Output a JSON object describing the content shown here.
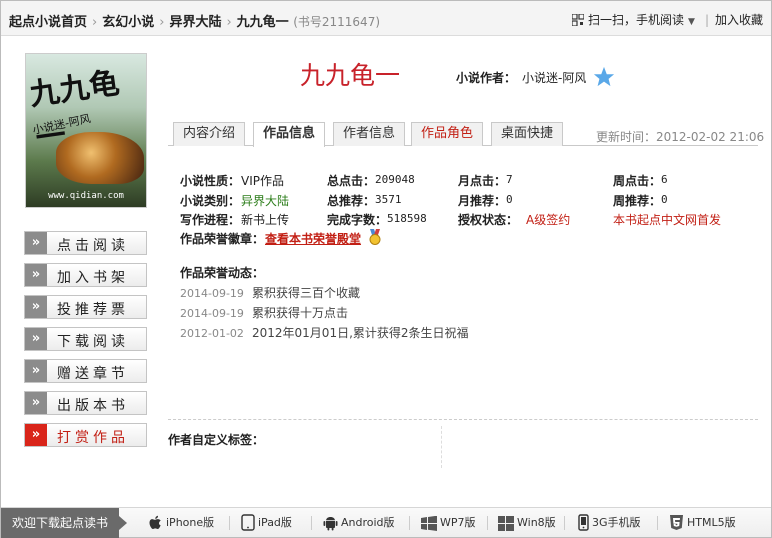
{
  "breadcrumb": {
    "items": [
      "起点小说首页",
      "玄幻小说",
      "异界大陆",
      "九九龟一"
    ],
    "book_no": "(书号2111647)"
  },
  "header_links": {
    "scan": "扫一扫，手机阅读",
    "bookshelf": "加入收藏"
  },
  "cover": {
    "title_text": "九九龟一",
    "author_text": "小说迷-阿风",
    "site_text": "www.qidian.com"
  },
  "left_buttons": [
    "点击阅读",
    "加入书架",
    "投推荐票",
    "下载阅读",
    "赠送章节",
    "出版本书",
    "打赏作品"
  ],
  "book": {
    "title": "九九龟一",
    "author_label": "小说作者：",
    "author_name": "小说迷-阿风"
  },
  "tabs": [
    "内容介绍",
    "作品信息",
    "作者信息",
    "作品角色",
    "桌面快捷"
  ],
  "updated": "更新时间：2012-02-02 21:06",
  "info": {
    "nature_label": "小说性质：",
    "nature_value": "VIP作品",
    "total_clicks_label": "总点击：",
    "total_clicks_value": "209048",
    "month_clicks_label": "月点击：",
    "month_clicks_value": "7",
    "week_clicks_label": "周点击：",
    "week_clicks_value": "6",
    "category_label": "小说类别：",
    "category_value": "异界大陆",
    "total_rec_label": "总推荐：",
    "total_rec_value": "3571",
    "month_rec_label": "月推荐：",
    "month_rec_value": "0",
    "week_rec_label": "周推荐：",
    "week_rec_value": "0",
    "progress_label": "写作进程：",
    "progress_value": "新书上传",
    "words_label": "完成字数：",
    "words_value": "518598",
    "license_label": "授权状态：",
    "license_value": "A级签约",
    "first_pub": "本书起点中文网首发",
    "honor_badge_label": "作品荣誉徽章：",
    "honor_badge_link": "查看本书荣誉殿堂"
  },
  "honors": {
    "title": "作品荣誉动态：",
    "rows": [
      {
        "date": "2014-09-19",
        "text": "累积获得三百个收藏"
      },
      {
        "date": "2014-09-19",
        "text": "累积获得十万点击"
      },
      {
        "date": "2012-01-02",
        "text": "2012年01月01日,累计获得2条生日祝福"
      }
    ]
  },
  "tags_label": "作者自定义标签：",
  "bottom": {
    "download": "欢迎下载起点读书",
    "platforms": [
      "iPhone版",
      "iPad版",
      "Android版",
      "WP7版",
      "Win8版",
      "3G手机版",
      "HTML5版"
    ]
  },
  "colors": {
    "accent_red": "#c21f14",
    "title_red": "#c8222a",
    "category_green": "#2c7d1a",
    "star_blue": "#5aa8e8"
  }
}
